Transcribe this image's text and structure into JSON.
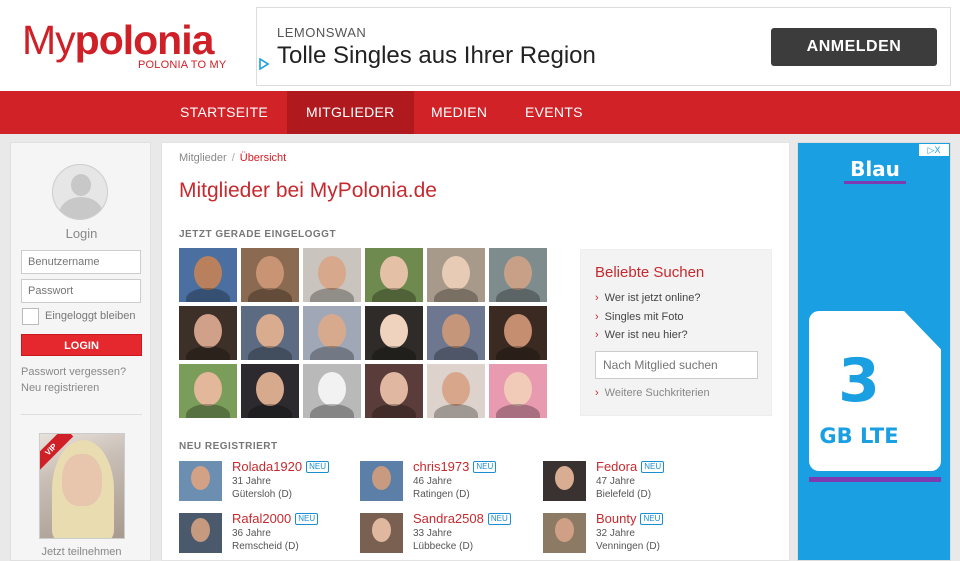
{
  "logo": {
    "part1": "My",
    "part2": "polonia",
    "tagline": "POLONIA TO MY"
  },
  "top_ad": {
    "brand": "LEMONSWAN",
    "headline": "Tolle Singles aus Ihrer Region",
    "button": "ANMELDEN"
  },
  "nav": [
    {
      "label": "STARTSEITE",
      "active": false
    },
    {
      "label": "MITGLIEDER",
      "active": true
    },
    {
      "label": "MEDIEN",
      "active": false
    },
    {
      "label": "EVENTS",
      "active": false
    }
  ],
  "sidebar": {
    "login_title": "Login",
    "username_placeholder": "Benutzername",
    "password_placeholder": "Passwort",
    "remember_label": "Eingeloggt bleiben",
    "login_button": "LOGIN",
    "forgot_password": "Passwort vergessen?",
    "register": "Neu registrieren",
    "vip_badge": "VIP",
    "join_text": "Jetzt teilnehmen"
  },
  "main": {
    "breadcrumb": {
      "parent": "Mitglieder",
      "separator": "/",
      "current": "Übersicht"
    },
    "title": "Mitglieder bei MyPolonia.de",
    "online_heading": "JETZT GERADE EINGELOGGT",
    "new_heading": "NEU REGISTRIERT"
  },
  "popular_search": {
    "title": "Beliebte Suchen",
    "links": [
      "Wer ist jetzt online?",
      "Singles mit Foto",
      "Wer ist neu hier?"
    ],
    "search_placeholder": "Nach Mitglied suchen",
    "more_link": "Weitere Suchkriterien"
  },
  "online_photos": [
    {
      "bg": "#4a6fa0",
      "face": "#b9805e"
    },
    {
      "bg": "#8a6a50",
      "face": "#c99474"
    },
    {
      "bg": "#c9c4bd",
      "face": "#d7a88c"
    },
    {
      "bg": "#6f8a4e",
      "face": "#e4c0a6"
    },
    {
      "bg": "#a89a8a",
      "face": "#e8cbb5"
    },
    {
      "bg": "#7e8c8e",
      "face": "#c8a088"
    },
    {
      "bg": "#3d3028",
      "face": "#d1a089"
    },
    {
      "bg": "#5c6b82",
      "face": "#d9ab8f"
    },
    {
      "bg": "#a0a8b8",
      "face": "#d7aa8e"
    },
    {
      "bg": "#2e2b28",
      "face": "#efd3bf"
    },
    {
      "bg": "#6d7890",
      "face": "#c6967a"
    },
    {
      "bg": "#3a2a22",
      "face": "#c68e70"
    },
    {
      "bg": "#7b9d5a",
      "face": "#e2b79a"
    },
    {
      "bg": "#2c2a2e",
      "face": "#d7a98d"
    },
    {
      "bg": "#b9b9b9",
      "face": "#f2f2f2"
    },
    {
      "bg": "#5a3d3a",
      "face": "#e0b7a1"
    },
    {
      "bg": "#ddd3cc",
      "face": "#d8a78b"
    },
    {
      "bg": "#e89ab0",
      "face": "#f2cbb8"
    }
  ],
  "new_members": [
    {
      "name": "Rolada1920",
      "badge": "NEU",
      "age": "31 Jahre",
      "location": "Gütersloh (D)",
      "bg": "#6c8eb0",
      "face": "#d3a186"
    },
    {
      "name": "chris1973",
      "badge": "NEU",
      "age": "46 Jahre",
      "location": "Ratingen (D)",
      "bg": "#5b7fa6",
      "face": "#c89a7f"
    },
    {
      "name": "Fedora",
      "badge": "NEU",
      "age": "47 Jahre",
      "location": "Bielefeld (D)",
      "bg": "#3a3230",
      "face": "#d9ad92"
    },
    {
      "name": "Rafal2000",
      "badge": "NEU",
      "age": "36 Jahre",
      "location": "Remscheid (D)",
      "bg": "#4a5a6c",
      "face": "#c69a7e"
    },
    {
      "name": "Sandra2508",
      "badge": "NEU",
      "age": "33 Jahre",
      "location": "Lübbecke (D)",
      "bg": "#7a6050",
      "face": "#e0b89f"
    },
    {
      "name": "Bounty",
      "badge": "NEU",
      "age": "32 Jahre",
      "location": "Venningen (D)",
      "bg": "#8c7a64",
      "face": "#cfa085"
    }
  ],
  "right_ad": {
    "brand": "Blau",
    "big": "3",
    "small": "GB LTE",
    "adchoice": "▷X"
  },
  "colors": {
    "brand_red": "#d12228",
    "nav_active": "#b01a1f",
    "link_red": "#c62a2f",
    "new_badge": "#1a8ed1",
    "ad_blue": "#1a9fe2",
    "ad_purple": "#7d3bb1"
  }
}
